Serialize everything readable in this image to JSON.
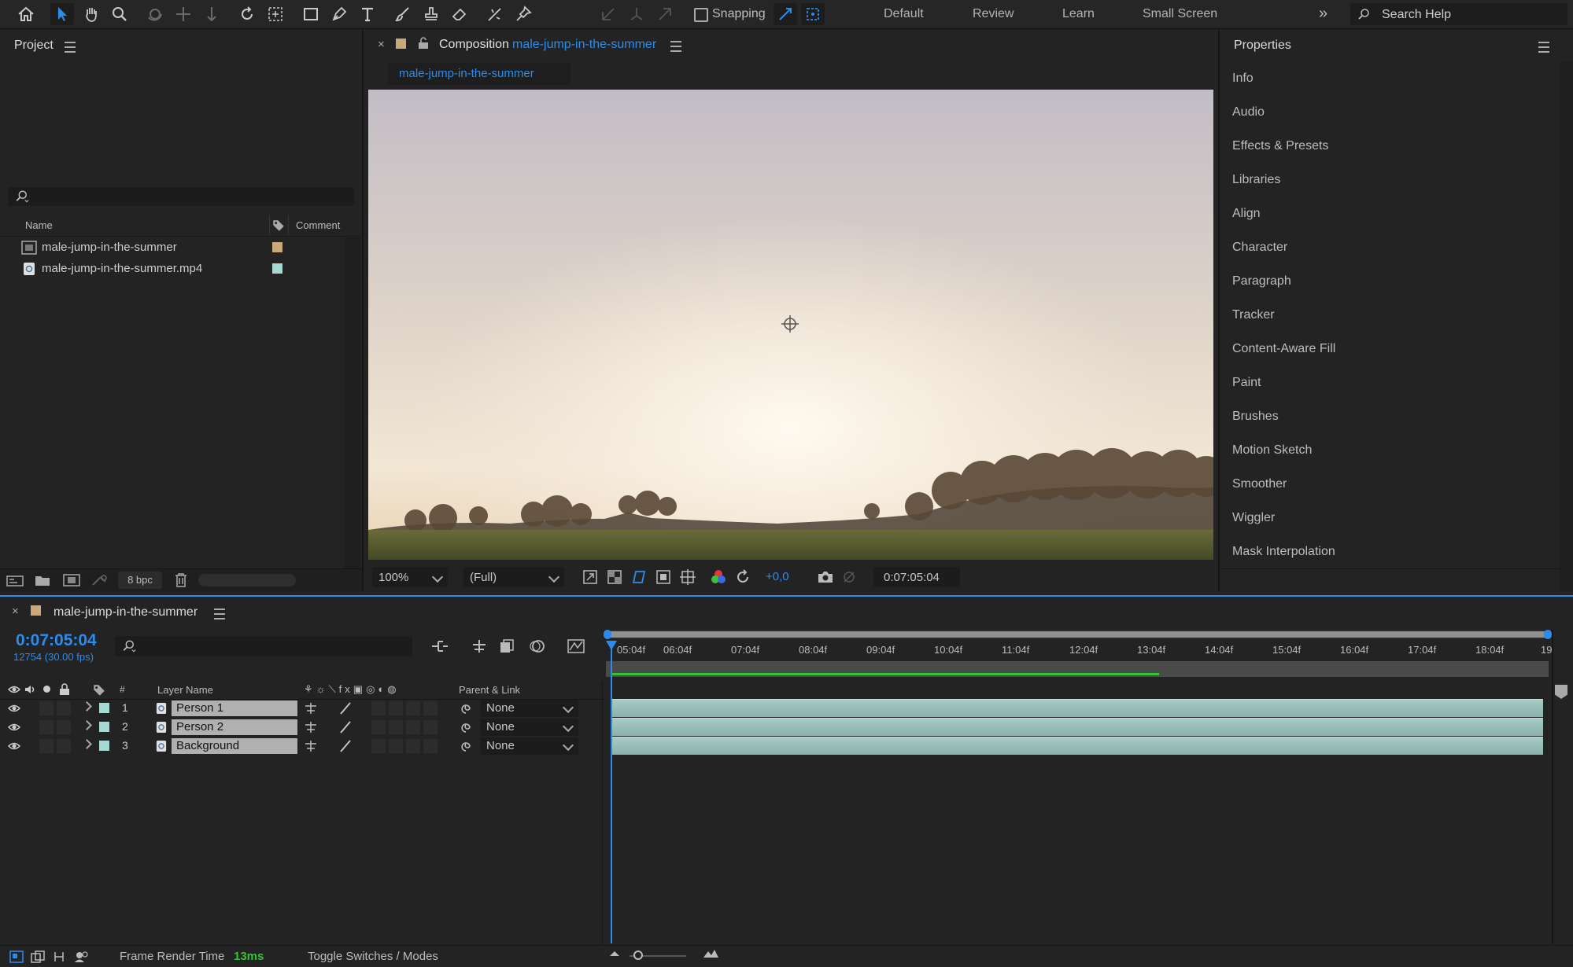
{
  "toolbar": {
    "snapping_label": "Snapping",
    "workspaces": [
      "Default",
      "Review",
      "Learn",
      "Small Screen"
    ],
    "search_placeholder": "Search Help"
  },
  "project": {
    "title": "Project",
    "columns": {
      "name": "Name",
      "comment": "Comment"
    },
    "items": [
      {
        "name": "male-jump-in-the-summer",
        "color": "#c9a97a",
        "type": "composition"
      },
      {
        "name": "male-jump-in-the-summer.mp4",
        "color": "#a8d8d4",
        "type": "footage"
      }
    ],
    "bpc": "8 bpc"
  },
  "composition": {
    "panel_label": "Composition",
    "comp_name": "male-jump-in-the-summer",
    "tab": "male-jump-in-the-summer",
    "zoom": "100%",
    "resolution": "(Full)",
    "exposure": "+0,0",
    "timecode": "0:07:05:04"
  },
  "properties": {
    "title": "Properties",
    "items": [
      "Info",
      "Audio",
      "Effects & Presets",
      "Libraries",
      "Align",
      "Character",
      "Paragraph",
      "Tracker",
      "Content-Aware Fill",
      "Paint",
      "Brushes",
      "Motion Sketch",
      "Smoother",
      "Wiggler",
      "Mask Interpolation"
    ]
  },
  "timeline": {
    "comp_name": "male-jump-in-the-summer",
    "timecode": "0:07:05:04",
    "frame_info": "12754 (30.00 fps)",
    "header": {
      "num": "#",
      "layer_name": "Layer Name",
      "parent": "Parent & Link"
    },
    "layers": [
      {
        "num": "1",
        "name": "Person 1",
        "parent": "None"
      },
      {
        "num": "2",
        "name": "Person 2",
        "parent": "None"
      },
      {
        "num": "3",
        "name": "Background",
        "parent": "None"
      }
    ],
    "ruler": [
      "05:04f",
      "06:04f",
      "07:04f",
      "08:04f",
      "09:04f",
      "10:04f",
      "11:04f",
      "12:04f",
      "13:04f",
      "14:04f",
      "15:04f",
      "16:04f",
      "17:04f",
      "18:04f",
      "19"
    ],
    "footer": {
      "render_label": "Frame Render Time",
      "render_value": "13ms",
      "toggle": "Toggle Switches / Modes"
    }
  },
  "colors": {
    "accent": "#2d8ceb",
    "layer_label": "#a8d8d4",
    "layer_bar": "#9cc4be",
    "work_area": "#34c334"
  }
}
